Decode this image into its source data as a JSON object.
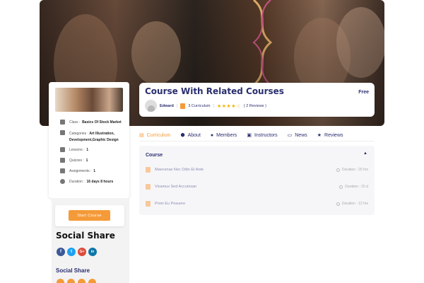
{
  "course": {
    "title": "Course With Related Courses",
    "price": "Free",
    "instructor": "Edward",
    "curriculum_count": "3 Curriculum",
    "stars": "★★★★☆",
    "reviews": "( 2 Reviews )"
  },
  "sidebar": {
    "meta": [
      {
        "label": "Class :",
        "value": "Basics Of Stock Market",
        "icon": "class-icon"
      },
      {
        "label": "Categories :",
        "value": "Art Illustration, Development,Graphic Design",
        "icon": "bookmark-icon"
      },
      {
        "label": "Lessons :",
        "value": "1",
        "icon": "lessons-icon"
      },
      {
        "label": "Quizzes :",
        "value": "1",
        "icon": "quiz-icon"
      },
      {
        "label": "Assignments :",
        "value": "1",
        "icon": "assignment-icon"
      },
      {
        "label": "Duration :",
        "value": "16 days 8 hours",
        "icon": "clock-icon"
      }
    ],
    "start_button": "Start Course",
    "social_title": "Social Share",
    "social_subtitle": "Social Share",
    "social_icons": [
      {
        "name": "facebook-icon",
        "glyph": "f",
        "color": "#3b5998"
      },
      {
        "name": "twitter-icon",
        "glyph": "t",
        "color": "#1da1f2"
      },
      {
        "name": "google-plus-icon",
        "glyph": "G+",
        "color": "#dd4b39"
      },
      {
        "name": "linkedin-icon",
        "glyph": "in",
        "color": "#0e76a8"
      }
    ]
  },
  "tabs": [
    {
      "label": "Curriculum",
      "icon": "book-icon",
      "glyph": "▤",
      "active": true
    },
    {
      "label": "About",
      "icon": "cap-icon",
      "glyph": "⬢",
      "active": false
    },
    {
      "label": "Members",
      "icon": "user-icon",
      "glyph": "●",
      "active": false
    },
    {
      "label": "Instructors",
      "icon": "id-card-icon",
      "glyph": "▣",
      "active": false
    },
    {
      "label": "News",
      "icon": "news-icon",
      "glyph": "▭",
      "active": false
    },
    {
      "label": "Reviews",
      "icon": "star-icon",
      "glyph": "★",
      "active": false
    }
  ],
  "curriculum": {
    "heading": "Course",
    "lessons": [
      {
        "title": "Maecenas Nec Odio Et Ante",
        "duration": "Duration : 20 hrs"
      },
      {
        "title": "Vivamus Sed Accumsan",
        "duration": "Duration : 15 d"
      },
      {
        "title": "Proin Eu Posuere",
        "duration": "Duration : 12 hrs"
      }
    ]
  },
  "colors": {
    "accent": "#f59a38",
    "navy": "#2a2e6e"
  }
}
